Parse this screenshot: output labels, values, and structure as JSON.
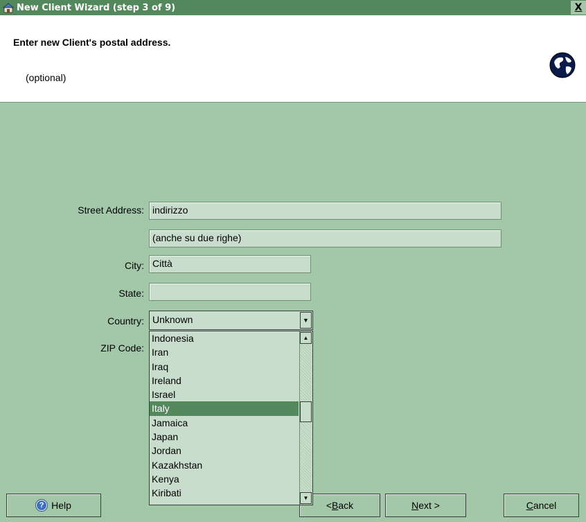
{
  "window": {
    "title": "New Client Wizard  (step 3 of 9)",
    "close_label": "X"
  },
  "header": {
    "heading": "Enter new Client's postal address.",
    "subtitle": "(optional)"
  },
  "form": {
    "street_label": "Street Address:",
    "street_line1": "indirizzo",
    "street_line2": "(anche su due righe)",
    "city_label": "City:",
    "city_value": "Città",
    "state_label": "State:",
    "state_value": "",
    "country_label": "Country:",
    "country_value": "Unknown",
    "zip_label": "ZIP Code:"
  },
  "dropdown": {
    "items": [
      "Indonesia",
      "Iran",
      "Iraq",
      "Ireland",
      "Israel",
      "Italy",
      "Jamaica",
      "Japan",
      "Jordan",
      "Kazakhstan",
      "Kenya",
      "Kiribati"
    ],
    "selected": "Italy"
  },
  "buttons": {
    "help": "Help",
    "back_prefix": "< ",
    "back_mnemonic": "B",
    "back_rest": "ack",
    "next_mnemonic": "N",
    "next_rest": "ext >",
    "cancel_mnemonic": "C",
    "cancel_rest": "ancel"
  },
  "colors": {
    "title_bar": "#53885d",
    "panel_bg": "#a3c7a9",
    "field_bg": "#c8ddcb",
    "selected_item": "#53885d"
  },
  "icons": {
    "app": "house-icon",
    "globe": "globe-icon",
    "help": "help-icon"
  }
}
